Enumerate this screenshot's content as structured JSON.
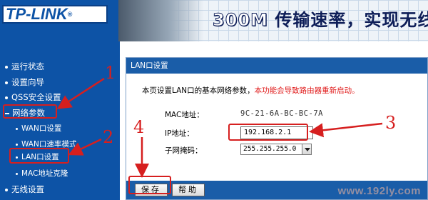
{
  "header": {
    "logo_text": "TP-LINK",
    "logo_mark": "®",
    "slogan_speed": "300M",
    "slogan_text": "传输速率，实现无线"
  },
  "sidebar": {
    "items": [
      {
        "label": "运行状态"
      },
      {
        "label": "设置向导"
      },
      {
        "label": "QSS安全设置"
      },
      {
        "label": "网络参数"
      },
      {
        "label": "WAN口设置"
      },
      {
        "label": "WAN口速率模式"
      },
      {
        "label": "LAN口设置"
      },
      {
        "label": "MAC地址克隆"
      },
      {
        "label": "无线设置"
      }
    ]
  },
  "panel": {
    "title": "LAN口设置",
    "intro": "本页设置LAN口的基本网络参数，",
    "warning": "本功能会导致路由器重新启动。",
    "mac_label": "MAC地址：",
    "mac_value": "9C-21-6A-BC-BC-7A",
    "ip_label": "IP地址：",
    "ip_value": "192.168.2.1",
    "mask_label": "子网掩码：",
    "mask_value": "255.255.255.0"
  },
  "buttons": {
    "save": "保存",
    "help": "帮助"
  },
  "annotations": {
    "step1": "1",
    "step2": "2",
    "step3": "3",
    "step4": "4",
    "color": "#d61f1f"
  },
  "watermark": "www.192ly.com",
  "colors": {
    "nav_bg": "#0d53a6",
    "panel_head": "#1a5da8",
    "warning": "#e01b1b"
  }
}
